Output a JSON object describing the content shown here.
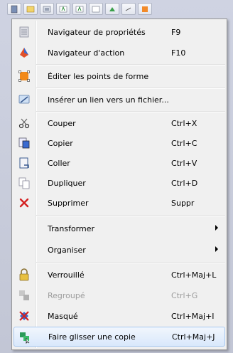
{
  "toolbar": {
    "buttons": [
      "selection-icon",
      "shape-icon",
      "picture-icon",
      "text-icon",
      "text-icon",
      "table-icon",
      "link-icon",
      "arrow-icon",
      "shape-edit-icon"
    ]
  },
  "menu": {
    "items": [
      {
        "label": "Navigateur de propriétés",
        "shortcut": "F9",
        "icon": "properties-icon"
      },
      {
        "label": "Navigateur d'action",
        "shortcut": "F10",
        "icon": "action-icon"
      },
      {
        "label": "Éditer les points de forme",
        "shortcut": "",
        "icon": "shape-points-icon"
      },
      {
        "label": "Insérer un lien vers un fichier...",
        "shortcut": "",
        "icon": "file-link-icon"
      },
      {
        "label": "Couper",
        "shortcut": "Ctrl+X",
        "icon": "scissors-icon"
      },
      {
        "label": "Copier",
        "shortcut": "Ctrl+C",
        "icon": "copy-icon"
      },
      {
        "label": "Coller",
        "shortcut": "Ctrl+V",
        "icon": "paste-icon"
      },
      {
        "label": "Dupliquer",
        "shortcut": "Ctrl+D",
        "icon": "duplicate-icon"
      },
      {
        "label": "Supprimer",
        "shortcut": "Suppr",
        "icon": "delete-icon"
      },
      {
        "label": "Transformer",
        "shortcut": "",
        "icon": "",
        "submenu": true
      },
      {
        "label": "Organiser",
        "shortcut": "",
        "icon": "",
        "submenu": true
      },
      {
        "label": "Verrouillé",
        "shortcut": "Ctrl+Maj+L",
        "icon": "lock-icon"
      },
      {
        "label": "Regroupé",
        "shortcut": "Ctrl+G",
        "icon": "group-icon",
        "disabled": true
      },
      {
        "label": "Masqué",
        "shortcut": "Ctrl+Maj+I",
        "icon": "hidden-icon"
      },
      {
        "label": "Faire glisser une copie",
        "shortcut": "Ctrl+Maj+J",
        "icon": "drag-copy-icon",
        "highlighted": true
      }
    ]
  }
}
